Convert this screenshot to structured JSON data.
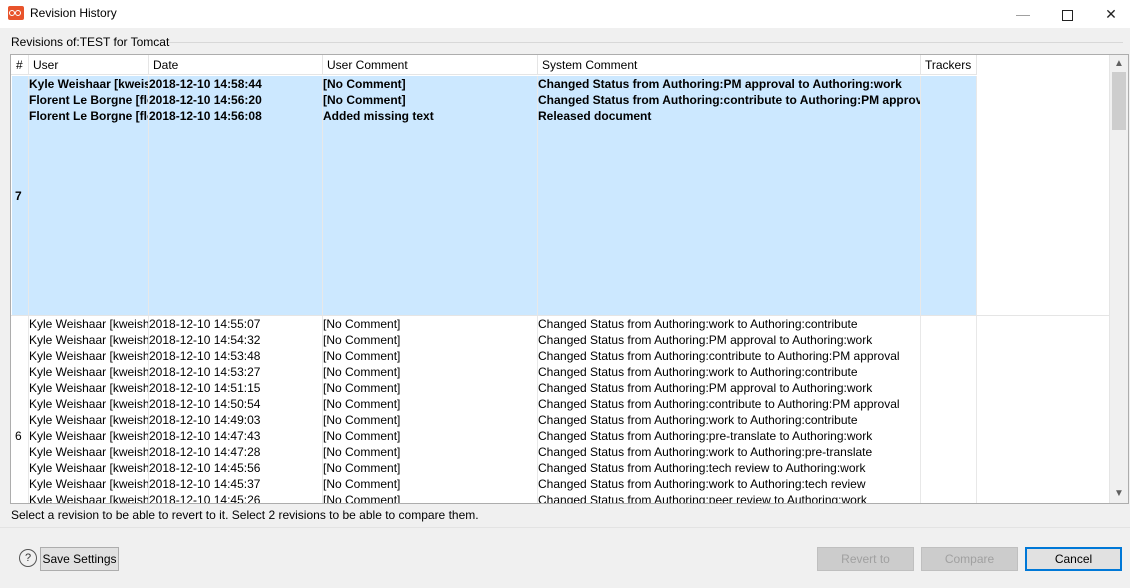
{
  "window": {
    "title": "Revision History",
    "minimize_glyph": "—",
    "close_glyph": "✕"
  },
  "group_label": "Revisions of:TEST for Tomcat",
  "table": {
    "headers": {
      "num": "#",
      "user": "User",
      "date": "Date",
      "user_comment": "User Comment",
      "system_comment": "System Comment",
      "trackers": "Trackers"
    },
    "selected_group": {
      "number": "7",
      "rows": [
        {
          "user": "Kyle Weishaar [kweishaar]",
          "date": "2018-12-10 14:58:44",
          "comment": "[No Comment]",
          "system": "Changed Status from Authoring:PM approval to Authoring:work"
        },
        {
          "user": "Florent Le Borgne [fleborgne]",
          "date": "2018-12-10 14:56:20",
          "comment": "[No Comment]",
          "system": "Changed Status from Authoring:contribute to Authoring:PM approval"
        },
        {
          "user": "Florent Le Borgne [fleborgne]",
          "date": "2018-12-10 14:56:08",
          "comment": "Added missing text",
          "system": "Released document"
        }
      ]
    },
    "group": {
      "number": "6",
      "rows": [
        {
          "user": "Kyle Weishaar [kweishaar]",
          "date": "2018-12-10 14:55:07",
          "comment": "[No Comment]",
          "system": "Changed Status from Authoring:work to Authoring:contribute"
        },
        {
          "user": "Kyle Weishaar [kweishaar]",
          "date": "2018-12-10 14:54:32",
          "comment": "[No Comment]",
          "system": "Changed Status from Authoring:PM approval to Authoring:work"
        },
        {
          "user": "Kyle Weishaar [kweishaar]",
          "date": "2018-12-10 14:53:48",
          "comment": "[No Comment]",
          "system": "Changed Status from Authoring:contribute to Authoring:PM approval"
        },
        {
          "user": "Kyle Weishaar [kweishaar]",
          "date": "2018-12-10 14:53:27",
          "comment": "[No Comment]",
          "system": "Changed Status from Authoring:work to Authoring:contribute"
        },
        {
          "user": "Kyle Weishaar [kweishaar]",
          "date": "2018-12-10 14:51:15",
          "comment": "[No Comment]",
          "system": "Changed Status from Authoring:PM approval to Authoring:work"
        },
        {
          "user": "Kyle Weishaar [kweishaar]",
          "date": "2018-12-10 14:50:54",
          "comment": "[No Comment]",
          "system": "Changed Status from Authoring:contribute to Authoring:PM approval"
        },
        {
          "user": "Kyle Weishaar [kweishaar]",
          "date": "2018-12-10 14:49:03",
          "comment": "[No Comment]",
          "system": "Changed Status from Authoring:work to Authoring:contribute"
        },
        {
          "user": "Kyle Weishaar [kweishaar]",
          "date": "2018-12-10 14:47:43",
          "comment": "[No Comment]",
          "system": "Changed Status from Authoring:pre-translate to Authoring:work"
        },
        {
          "user": "Kyle Weishaar [kweishaar]",
          "date": "2018-12-10 14:47:28",
          "comment": "[No Comment]",
          "system": "Changed Status from Authoring:work to Authoring:pre-translate"
        },
        {
          "user": "Kyle Weishaar [kweishaar]",
          "date": "2018-12-10 14:45:56",
          "comment": "[No Comment]",
          "system": "Changed Status from Authoring:tech review to Authoring:work"
        },
        {
          "user": "Kyle Weishaar [kweishaar]",
          "date": "2018-12-10 14:45:37",
          "comment": "[No Comment]",
          "system": "Changed Status from Authoring:work to Authoring:tech review"
        },
        {
          "user": "Kyle Weishaar [kweishaar]",
          "date": "2018-12-10 14:45:26",
          "comment": "[No Comment]",
          "system": "Changed Status from Authoring:peer review to Authoring:work"
        }
      ]
    }
  },
  "status_text": "Select a revision to be able to revert to it. Select 2 revisions to be able to compare them.",
  "buttons": {
    "help": "?",
    "save_settings": "Save Settings",
    "revert_to": "Revert to",
    "compare": "Compare",
    "cancel": "Cancel"
  },
  "colors": {
    "selection": "#cce8ff",
    "default_button_border": "#0078d7",
    "app_icon": "#e8532b"
  }
}
